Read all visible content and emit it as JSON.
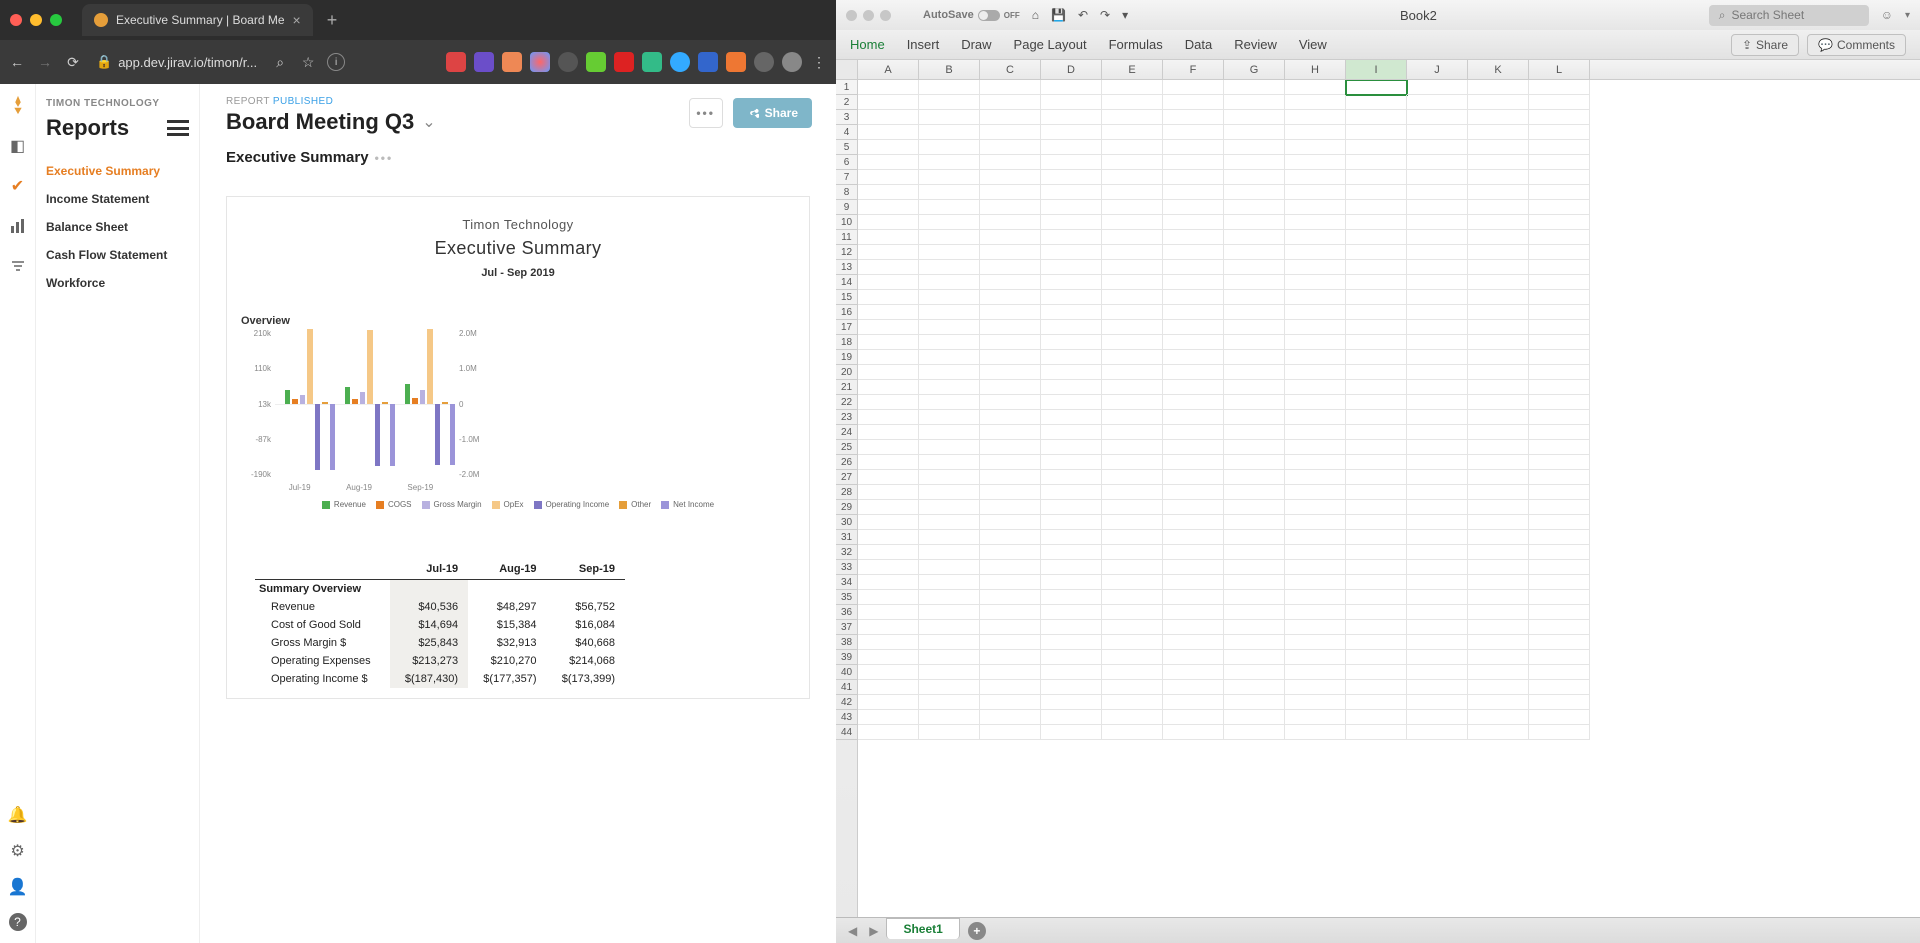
{
  "browser": {
    "tab_title": "Executive Summary | Board Me",
    "url": "app.dev.jirav.io/timon/r...",
    "new_tab_label": "+"
  },
  "app": {
    "company": "TIMON TECHNOLOGY",
    "section": "Reports",
    "nav": [
      {
        "label": "Executive Summary",
        "active": true
      },
      {
        "label": "Income Statement",
        "active": false
      },
      {
        "label": "Balance Sheet",
        "active": false
      },
      {
        "label": "Cash Flow Statement",
        "active": false
      },
      {
        "label": "Workforce",
        "active": false
      }
    ],
    "report_status_label": "REPORT",
    "report_status_value": "PUBLISHED",
    "report_title": "Board Meeting Q3",
    "share_label": "Share",
    "more_label": "•••",
    "subtitle": "Executive Summary"
  },
  "card": {
    "company": "Timon Technology",
    "title": "Executive Summary",
    "period": "Jul - Sep 2019",
    "overview_label": "Overview"
  },
  "chart_data": {
    "type": "bar",
    "categories": [
      "Jul-19",
      "Aug-19",
      "Sep-19"
    ],
    "y_left_ticks": [
      "210k",
      "110k",
      "13k",
      "-87k",
      "-190k"
    ],
    "y_right_ticks": [
      "2.0M",
      "1.0M",
      "0",
      "-1.0M",
      "-2.0M"
    ],
    "series": [
      {
        "name": "Revenue",
        "color": "#4caf50",
        "values": [
          40536,
          48297,
          56752
        ]
      },
      {
        "name": "COGS",
        "color": "#e67e22",
        "values": [
          14694,
          15384,
          16084
        ]
      },
      {
        "name": "Gross Margin",
        "color": "#b8b1e0",
        "values": [
          25843,
          32913,
          40668
        ]
      },
      {
        "name": "OpEx",
        "color": "#f5c887",
        "values": [
          213273,
          210270,
          214068
        ]
      },
      {
        "name": "Operating Income",
        "color": "#7e76c4",
        "values": [
          -187430,
          -177357,
          -173399
        ]
      },
      {
        "name": "Other",
        "color": "#e59e3a",
        "values": [
          0,
          0,
          0
        ]
      },
      {
        "name": "Net Income",
        "color": "#9b94d9",
        "values": [
          -187430,
          -177357,
          -173399
        ]
      }
    ],
    "legend": [
      "Revenue",
      "COGS",
      "Gross Margin",
      "OpEx",
      "Operating Income",
      "Other",
      "Net Income"
    ]
  },
  "table": {
    "columns": [
      "",
      "Jul-19",
      "Aug-19",
      "Sep-19"
    ],
    "group_label": "Summary Overview",
    "rows": [
      {
        "label": "Revenue",
        "v": [
          "$40,536",
          "$48,297",
          "$56,752"
        ]
      },
      {
        "label": "Cost of Good Sold",
        "v": [
          "$14,694",
          "$15,384",
          "$16,084"
        ]
      },
      {
        "label": "Gross Margin $",
        "v": [
          "$25,843",
          "$32,913",
          "$40,668"
        ]
      },
      {
        "label": "Operating Expenses",
        "v": [
          "$213,273",
          "$210,270",
          "$214,068"
        ]
      },
      {
        "label": "Operating Income $",
        "v": [
          "$(187,430)",
          "$(177,357)",
          "$(173,399)"
        ]
      }
    ]
  },
  "excel": {
    "autosave_label": "AutoSave",
    "autosave_state": "OFF",
    "book_title": "Book2",
    "search_placeholder": "Search Sheet",
    "ribbon": [
      "Home",
      "Insert",
      "Draw",
      "Page Layout",
      "Formulas",
      "Data",
      "Review",
      "View"
    ],
    "share_label": "Share",
    "comments_label": "Comments",
    "columns": [
      "A",
      "B",
      "C",
      "D",
      "E",
      "F",
      "G",
      "H",
      "I",
      "J",
      "K",
      "L"
    ],
    "rows": 44,
    "selected_cell": "I1",
    "sheet_tab": "Sheet1"
  }
}
